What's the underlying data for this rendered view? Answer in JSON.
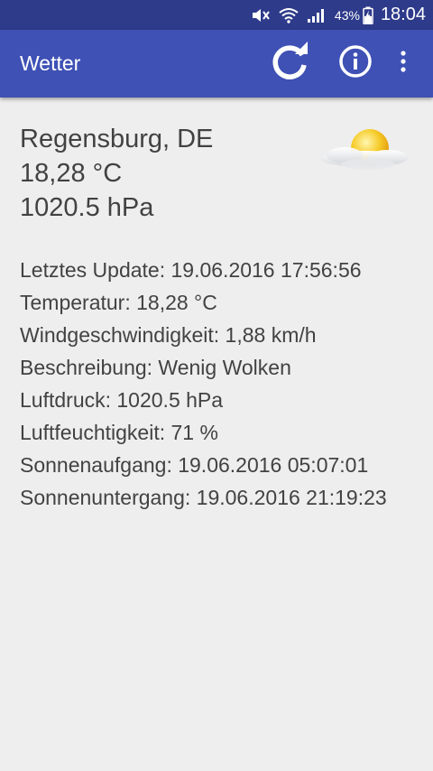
{
  "status_bar": {
    "battery_percent": "43%",
    "time": "18:04",
    "icons": [
      "mute-icon",
      "wifi-icon",
      "signal-icon",
      "battery-charging-icon"
    ]
  },
  "app_bar": {
    "title": "Wetter",
    "color": "#3f51b5",
    "status_color": "#2e3b8a",
    "actions": [
      "refresh-icon",
      "info-icon",
      "overflow-menu-icon"
    ]
  },
  "summary": {
    "city": "Regensburg, DE",
    "temperature": "18,28 °C",
    "pressure": "1020.5 hPa",
    "icon": "partly-cloudy-sun-icon"
  },
  "details": {
    "last_update": "Letztes Update: 19.06.2016 17:56:56",
    "temperature": "Temperatur: 18,28 °C",
    "wind_speed": "Windgeschwindigkeit: 1,88 km/h",
    "description": "Beschreibung: Wenig Wolken",
    "pressure": "Luftdruck: 1020.5 hPa",
    "humidity": "Luftfeuchtigkeit: 71 %",
    "sunrise": "Sonnenaufgang: 19.06.2016 05:07:01",
    "sunset": "Sonnenuntergang: 19.06.2016 21:19:23"
  }
}
